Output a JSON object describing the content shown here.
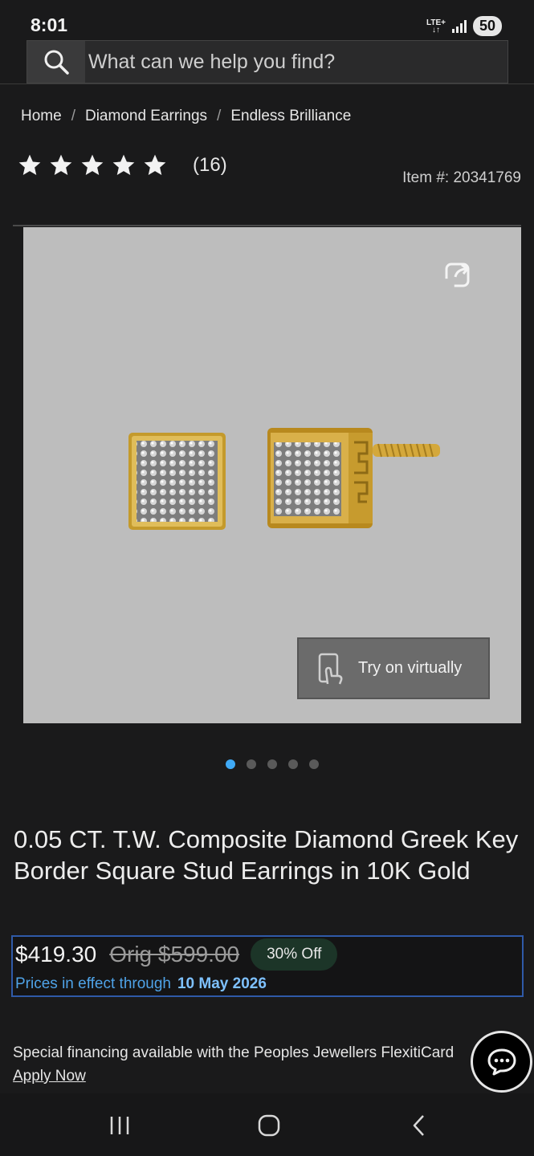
{
  "status_bar": {
    "time": "8:01",
    "network": "LTE+",
    "battery": "50"
  },
  "search": {
    "placeholder": "What can we help you find?"
  },
  "breadcrumb": {
    "items": [
      "Home",
      "Diamond Earrings",
      "Endless Brilliance"
    ],
    "separator": "/"
  },
  "rating": {
    "stars": 5,
    "review_count": "(16)"
  },
  "item_number": "Item #: 20341769",
  "gallery": {
    "try_on_label": "Try on virtually",
    "slide_count": 5,
    "active_slide": 0
  },
  "product": {
    "title": "0.05 CT. T.W. Composite Diamond Greek Key Border Square Stud Earrings in 10K Gold"
  },
  "pricing": {
    "sale_price": "$419.30",
    "orig_price": "Orig $599.00",
    "discount": "30% Off",
    "effect_label": "Prices in effect through",
    "effect_date": "10 May 2026"
  },
  "financing": {
    "text": "Special financing available with the Peoples Jewellers FlexitiCard",
    "apply_label": "Apply Now"
  },
  "colors": {
    "background": "#1a1a1b",
    "accent_blue": "#3fa9f5",
    "price_box_border": "#2f5aa8",
    "discount_badge": "#1c3528"
  },
  "icons": {
    "search": "search-icon",
    "share": "share-icon",
    "try_on": "hand-phone-icon",
    "chat": "chat-icon",
    "nav_recents": "recents-icon",
    "nav_home": "home-icon",
    "nav_back": "back-icon"
  }
}
